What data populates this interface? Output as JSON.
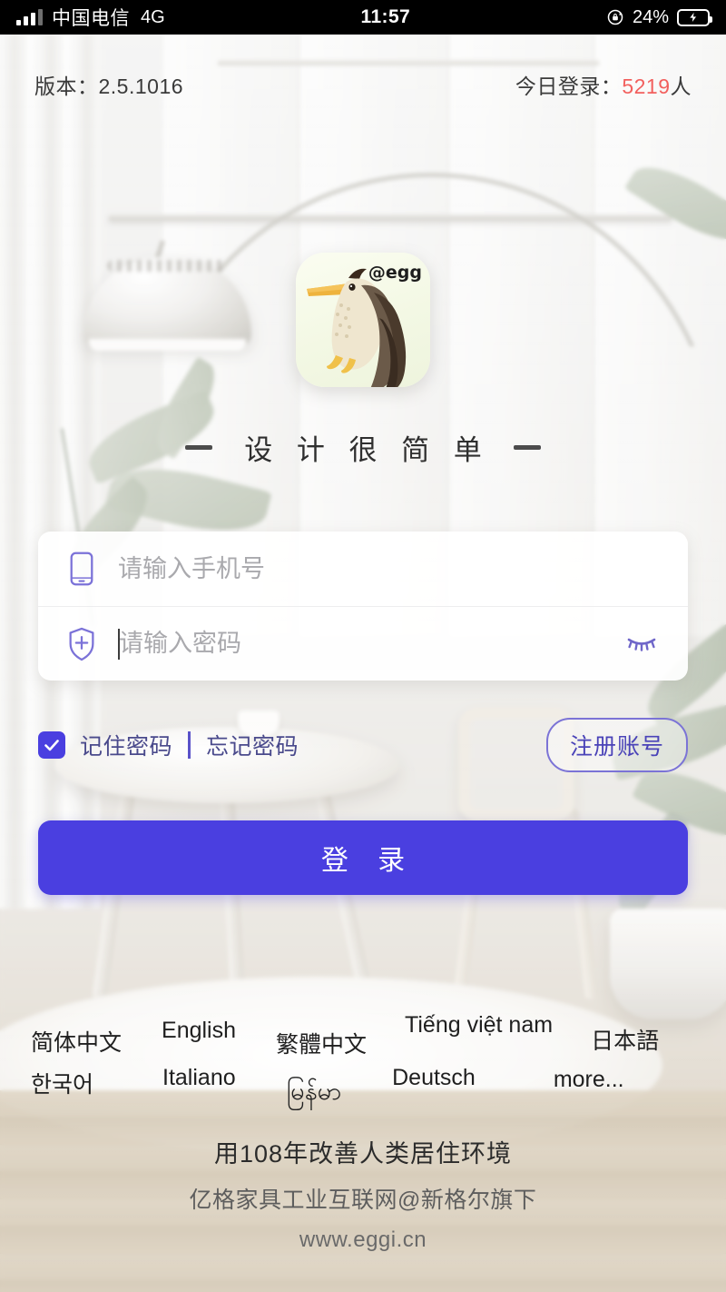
{
  "status_bar": {
    "carrier": "中国电信",
    "network": "4G",
    "time": "11:57",
    "battery_percent": "24%",
    "battery_level": 24,
    "charging": true,
    "rotation_lock": true,
    "signal_bars": 3,
    "background_color": "#000000"
  },
  "header": {
    "version_label": "版本：2.5.1016",
    "today_login_label": "今日登录：",
    "today_login_count": "5219",
    "today_login_suffix": "人",
    "count_color": "#f2605e"
  },
  "logo": {
    "badge_text": "@egg",
    "icon_name": "bird-logo"
  },
  "tagline": {
    "text": "设 计 很 简 单"
  },
  "form": {
    "phone": {
      "placeholder": "请输入手机号",
      "value": "",
      "icon": "mobile-phone-icon"
    },
    "password": {
      "placeholder": "请输入密码",
      "value": "",
      "icon": "shield-plus-icon",
      "toggle_icon": "eye-closed-icon",
      "visible": false
    }
  },
  "options": {
    "remember_label": "记住密码",
    "remember_checked": true,
    "forgot_label": "忘记密码",
    "register_label": "注册账号"
  },
  "login_button": {
    "label": "登 录",
    "color": "#4a3fe0"
  },
  "languages": {
    "row1": [
      {
        "label": "简体中文"
      },
      {
        "label": "English"
      },
      {
        "label": "繁體中文"
      },
      {
        "label": "Tiếng việt nam"
      },
      {
        "label": "日本語"
      }
    ],
    "row2": [
      {
        "label": "한국어"
      },
      {
        "label": "Italiano"
      },
      {
        "label": "မြန်မာ"
      },
      {
        "label": "Deutsch"
      },
      {
        "label": "more..."
      }
    ]
  },
  "footer": {
    "slogan": "用108年改善人类居住环境",
    "company": "亿格家具工业互联网@新格尔旗下",
    "website": "www.eggi.cn"
  }
}
